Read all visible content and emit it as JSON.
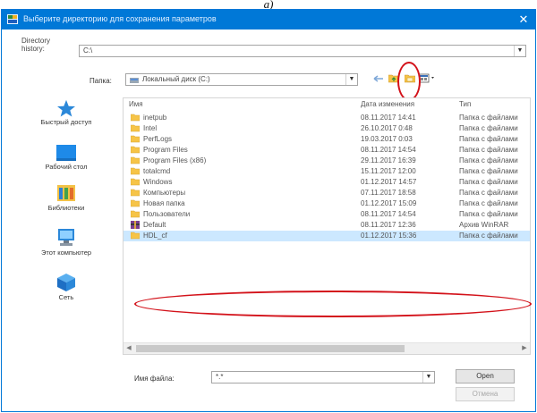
{
  "caption": "а)",
  "dialog": {
    "title": "Выберите директорию для сохранения параметров",
    "close_glyph": "✕"
  },
  "history": {
    "label": "Directory history:",
    "value": "C:\\"
  },
  "folder": {
    "label": "Папка:",
    "value": "Локальный диск (C:)"
  },
  "places": [
    {
      "label": "Быстрый доступ",
      "icon": "star-icon"
    },
    {
      "label": "Рабочий стол",
      "icon": "desktop-icon"
    },
    {
      "label": "Библиотеки",
      "icon": "libraries-icon"
    },
    {
      "label": "Этот компьютер",
      "icon": "computer-icon"
    },
    {
      "label": "Сеть",
      "icon": "network-icon"
    }
  ],
  "columns": {
    "name": "Имя",
    "date": "Дата изменения",
    "type": "Тип"
  },
  "files": [
    {
      "name": "inetpub",
      "date": "08.11.2017 14:41",
      "type": "Папка с файлами",
      "icon": "folder-icon"
    },
    {
      "name": "Intel",
      "date": "26.10.2017 0:48",
      "type": "Папка с файлами",
      "icon": "folder-icon"
    },
    {
      "name": "PerfLogs",
      "date": "19.03.2017 0:03",
      "type": "Папка с файлами",
      "icon": "folder-icon"
    },
    {
      "name": "Program Files",
      "date": "08.11.2017 14:54",
      "type": "Папка с файлами",
      "icon": "folder-icon"
    },
    {
      "name": "Program Files (x86)",
      "date": "29.11.2017 16:39",
      "type": "Папка с файлами",
      "icon": "folder-icon"
    },
    {
      "name": "totalcmd",
      "date": "15.11.2017 12:00",
      "type": "Папка с файлами",
      "icon": "folder-icon"
    },
    {
      "name": "Windows",
      "date": "01.12.2017 14:57",
      "type": "Папка с файлами",
      "icon": "folder-icon"
    },
    {
      "name": "Компьютеры",
      "date": "07.11.2017 18:58",
      "type": "Папка с файлами",
      "icon": "folder-icon"
    },
    {
      "name": "Новая папка",
      "date": "01.12.2017 15:09",
      "type": "Папка с файлами",
      "icon": "folder-icon"
    },
    {
      "name": "Пользователи",
      "date": "08.11.2017 14:54",
      "type": "Папка с файлами",
      "icon": "folder-icon"
    },
    {
      "name": "Default",
      "date": "08.11.2017 12:36",
      "type": "Архив WinRAR",
      "icon": "winrar-archive-icon"
    },
    {
      "name": "HDL_cf",
      "date": "01.12.2017 15:36",
      "type": "Папка с файлами",
      "icon": "folder-icon",
      "selected": true
    }
  ],
  "filename": {
    "label": "Имя файла:",
    "value": "*.*"
  },
  "buttons": {
    "open": "Open",
    "cancel": "Отмена"
  },
  "colors": {
    "titlebar": "#0078d7",
    "selection": "#cce8ff",
    "highlight": "#d3121a",
    "folder": "#f6c447"
  }
}
